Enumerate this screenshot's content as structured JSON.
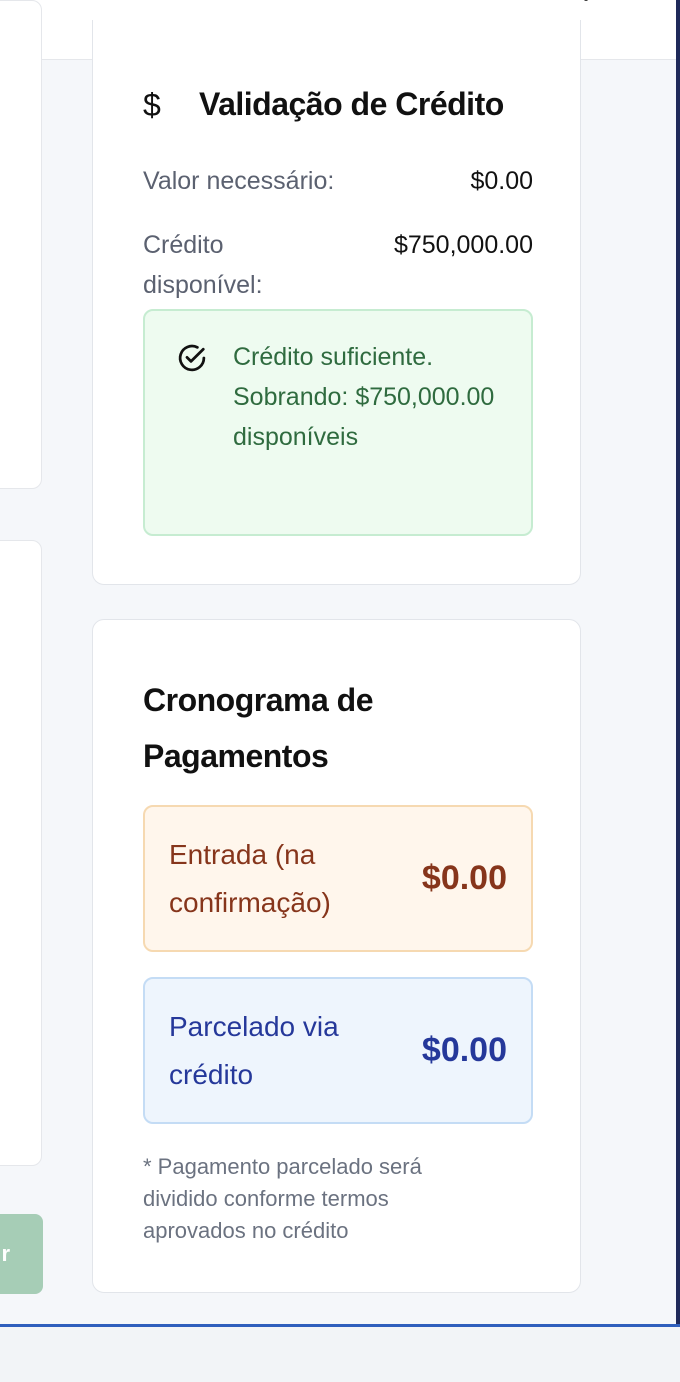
{
  "header": {
    "chevron_glyph": "˘"
  },
  "left_panel": {
    "button_fragment": "r"
  },
  "credit_validation": {
    "icon": "dollar-icon",
    "icon_glyph": "$",
    "title": "Validação de Crédito",
    "required_label": "Valor necessário:",
    "required_value": "$0.00",
    "available_label": "Crédito disponível:",
    "available_value": "$750,000.00",
    "status_icon": "check-circle-icon",
    "status_message": "Crédito suficiente. Sobrando: $750,000.00 disponíveis",
    "status_color": "#2f6b3f"
  },
  "payment_schedule": {
    "title": "Cronograma de Pagamentos",
    "down_payment_label": "Entrada (na confirmação)",
    "down_payment_value": "$0.00",
    "installments_label": "Parcelado via crédito",
    "installments_value": "$0.00",
    "footnote": "* Pagamento parcelado será dividido conforme termos aprovados no crédito"
  },
  "colors": {
    "success_bg": "#eefbf0",
    "down_payment_accent": "#86351b",
    "installments_accent": "#25389a",
    "primary_button": "#a6cdb6"
  }
}
